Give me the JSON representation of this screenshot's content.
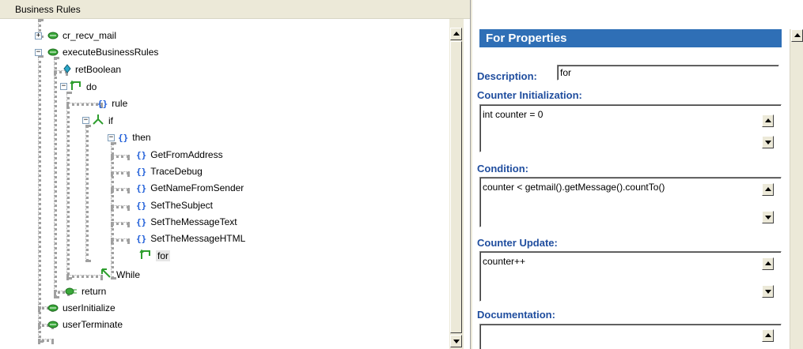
{
  "panel": {
    "title": "Business Rules"
  },
  "tree": {
    "nodes": [
      {
        "label": "cr_recv_mail",
        "icon": "method-icon"
      },
      {
        "label": "executeBusinessRules",
        "icon": "method-icon"
      },
      {
        "label": "retBoolean",
        "icon": "variable-icon"
      },
      {
        "label": "do",
        "icon": "loop-icon"
      },
      {
        "label": "rule",
        "icon": "braces-icon"
      },
      {
        "label": "if",
        "icon": "branch-icon"
      },
      {
        "label": "then",
        "icon": "braces-icon"
      },
      {
        "label": "GetFromAddress",
        "icon": "braces-icon"
      },
      {
        "label": "TraceDebug",
        "icon": "braces-icon"
      },
      {
        "label": "GetNameFromSender",
        "icon": "braces-icon"
      },
      {
        "label": "SetTheSubject",
        "icon": "braces-icon"
      },
      {
        "label": "SetTheMessageText",
        "icon": "braces-icon"
      },
      {
        "label": "SetTheMessageHTML",
        "icon": "braces-icon"
      },
      {
        "label": "for",
        "icon": "loop-icon"
      },
      {
        "label": "While",
        "icon": "arrow-icon"
      },
      {
        "label": "return",
        "icon": "return-icon"
      },
      {
        "label": "userInitialize",
        "icon": "method-icon"
      },
      {
        "label": "userTerminate",
        "icon": "method-icon"
      }
    ]
  },
  "properties": {
    "title": "For Properties",
    "description_label": "Description:",
    "description_value": "for",
    "counter_init_label": "Counter Initialization:",
    "counter_init_value": "int counter = 0",
    "condition_label": "Condition:",
    "condition_value": "counter < getmail().getMessage().countTo()",
    "counter_update_label": "Counter Update:",
    "counter_update_value": "counter++",
    "documentation_label": "Documentation:",
    "documentation_value": ""
  },
  "colors": {
    "accent": "#2f6fb6",
    "label": "#1f4d9e",
    "method": "#2e9e2e",
    "braces": "#1b5bd8"
  }
}
